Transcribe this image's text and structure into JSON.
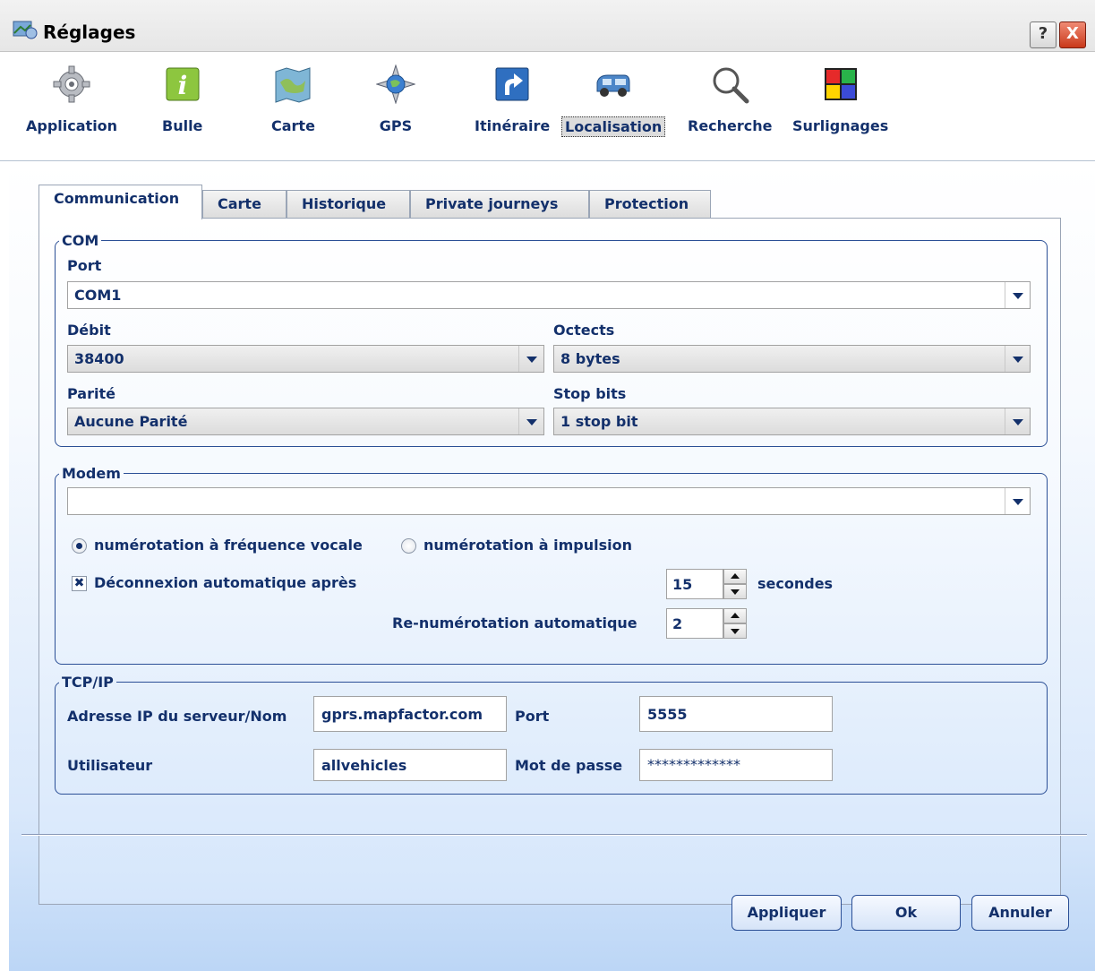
{
  "window": {
    "title": "Réglages",
    "help_label": "?",
    "close_label": "X"
  },
  "toolbar": {
    "items": [
      {
        "label": "Application",
        "icon": "gear-icon"
      },
      {
        "label": "Bulle",
        "icon": "info-bubble-icon"
      },
      {
        "label": "Carte",
        "icon": "map-icon"
      },
      {
        "label": "GPS",
        "icon": "globe-compass-icon"
      },
      {
        "label": "Itinéraire",
        "icon": "route-arrow-icon"
      },
      {
        "label": "Localisation",
        "icon": "van-icon",
        "selected": true
      },
      {
        "label": "Recherche",
        "icon": "magnifier-icon"
      },
      {
        "label": "Surlignages",
        "icon": "color-squares-icon"
      }
    ]
  },
  "tabs": [
    {
      "label": "Communication",
      "active": true
    },
    {
      "label": "Carte"
    },
    {
      "label": "Historique"
    },
    {
      "label": "Private journeys"
    },
    {
      "label": "Protection"
    }
  ],
  "com": {
    "legend": "COM",
    "port_label": "Port",
    "port_value": "COM1",
    "debit_label": "Débit",
    "debit_value": "38400",
    "octets_label": "Octects",
    "octets_value": "8 bytes",
    "parite_label": "Parité",
    "parite_value": "Aucune Parité",
    "stopbits_label": "Stop bits",
    "stopbits_value": "1 stop bit"
  },
  "modem": {
    "legend": "Modem",
    "modem_value": "",
    "radio_tone_label": "numérotation à fréquence vocale",
    "radio_tone_checked": true,
    "radio_pulse_label": "numérotation à impulsion",
    "radio_pulse_checked": false,
    "auto_disconnect_label": "Déconnexion automatique après",
    "auto_disconnect_checked": true,
    "checkbox_mark": "✖",
    "disconnect_seconds": "15",
    "seconds_label": "secondes",
    "redial_label": "Re-numérotation automatique",
    "redial_value": "2"
  },
  "tcpip": {
    "legend": "TCP/IP",
    "server_label": "Adresse IP du serveur/Nom",
    "server_value": "gprs.mapfactor.com",
    "port_label": "Port",
    "port_value": "5555",
    "user_label": "Utilisateur",
    "user_value": "allvehicles",
    "password_label": "Mot de passe",
    "password_value": "*************"
  },
  "buttons": {
    "apply": "Appliquer",
    "ok": "Ok",
    "cancel": "Annuler"
  },
  "colors": {
    "text": "#13306b",
    "border": "#2b4f96",
    "close": "#c9391a"
  }
}
